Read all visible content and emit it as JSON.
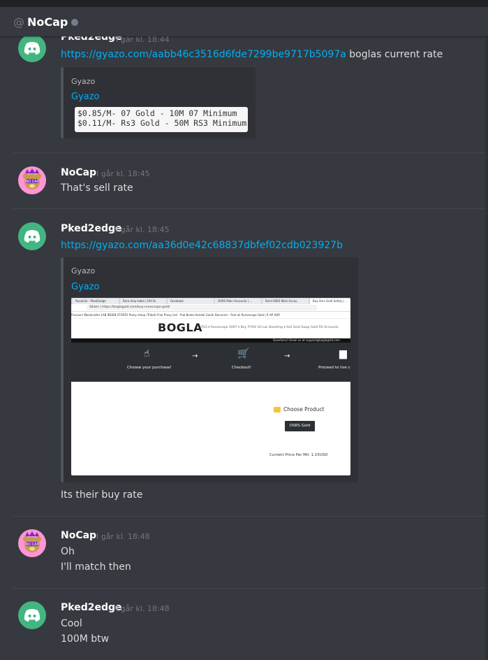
{
  "header": {
    "at": "@",
    "channel": "NoCap"
  },
  "messages": {
    "m1": {
      "author": "Pked2edge",
      "timestamp": "I går kl. 18:44",
      "link": "https://gyazo.com/aabb46c3516d6fde7299be9717b5097a",
      "text_after_link": "boglas current rate",
      "embed": {
        "provider": "Gyazo",
        "title": "Gyazo",
        "lines": [
          "$0.85/M- 07 Gold - 10M 07 Minimum",
          "$0.11/M- Rs3 Gold - 50M RS3 Minimum"
        ]
      }
    },
    "m2": {
      "author": "NoCap",
      "timestamp": "I går kl. 18:45",
      "text": "That's sell rate"
    },
    "m3": {
      "author": "Pked2edge",
      "timestamp": "I går kl. 18:45",
      "link": "https://gyazo.com/aa36d0e42c68837dbfef02cdb023927b",
      "embed": {
        "provider": "Gyazo",
        "title": "Gyazo",
        "screenshot": {
          "tabs": [
            "RuneLite - Pked2edge",
            "Rare drop table | Old Sc",
            "Facebook",
            "OSRS Main Accounts | ...",
            "Rent OSRS Main Accou",
            "Buy Osrs Gold Safely | ..."
          ],
          "url": "Sikker  |  https://boglagold.com/buy-runescape-gold/",
          "bookmarks": "Flavours Woodcutter    LAB INGEN STORFE    Proxy setup (Tribot)    Free Proxy List - Pub    Beste Handel Guide    Donnerer - Fast ak    Runescape Gold | R    AP  ADR",
          "logo": "BOGLA",
          "nav": "RS3 ▾   Runescape 2007 ▾   Buy FFXIV Gil   LoL Boosting ▾   Sell Gold   Swap Gold   RS Accounts",
          "email": "Questions? Email us at support@boglagold.com",
          "steps": [
            "Choose your purchase!",
            "Checkout!",
            "Proceed to live c"
          ],
          "choose_product": "Choose Product",
          "product_button": "OSRS Gold",
          "price": "Current Price Per Mil: 1.15USD"
        }
      },
      "text": "Its their buy rate"
    },
    "m4": {
      "author": "NoCap",
      "timestamp": "I går kl. 18:48",
      "lines": [
        "Oh",
        "I'll match then"
      ]
    },
    "m5": {
      "author": "Pked2edge",
      "timestamp": "I går kl. 18:48",
      "lines": [
        "Cool",
        "100M btw"
      ]
    }
  }
}
